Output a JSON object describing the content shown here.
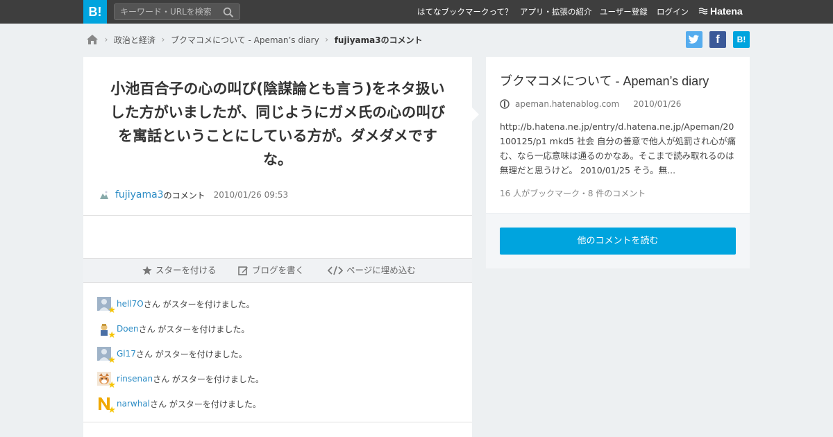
{
  "header": {
    "logo": "B!",
    "search_placeholder": "キーワード・URLを検索",
    "nav": [
      "はてなブックマークって？",
      "アプリ・拡張の紹介",
      "ユーザー登録",
      "ログイン"
    ],
    "brand": "Hatena"
  },
  "breadcrumb": {
    "items": [
      "政治と経済",
      "ブクマコメについて - Apeman’s diary"
    ],
    "current": "fujiyama3のコメント"
  },
  "share": {
    "twitter": "t",
    "facebook": "f",
    "hatena": "B!"
  },
  "comment": {
    "text": "小池百合子の心の叫び(陰謀論とも言う)をネタ扱いした方がいましたが、同じようにガメ氏の心の叫びを寓話ということにしている方が。ダメダメですな。",
    "user": "fujiyama3",
    "user_suffix": "のコメント",
    "date": "2010/01/26 09:53"
  },
  "actions": {
    "star": "スターを付ける",
    "blog": "ブログを書く",
    "embed": "ページに埋め込む"
  },
  "stars": {
    "suffix": "さん がスターを付けました。",
    "users": [
      "hell7O",
      "Doen",
      "Gl17",
      "rinsenan",
      "narwhal"
    ]
  },
  "entry": {
    "title": "ブクマコメについて - Apeman’s diary",
    "domain": "apeman.hatenablog.com",
    "date": "2010/01/26",
    "body": "http://b.hatena.ne.jp/entry/d.hatena.ne.jp/Apeman/20100125/p1 mkd5 社会 自分の善意で他人が処罰され心が痛む、なら一応意味は通るのかなあ。そこまで読み取れるのは無理だと思うけど。 2010/01/25 そう。無...",
    "count": "16 人がブックマーク・8 件のコメント",
    "read_more": "他のコメントを読む"
  },
  "colors": {
    "accent": "#00a4de",
    "header": "#3e3e3e",
    "link": "#2c8cc5"
  }
}
